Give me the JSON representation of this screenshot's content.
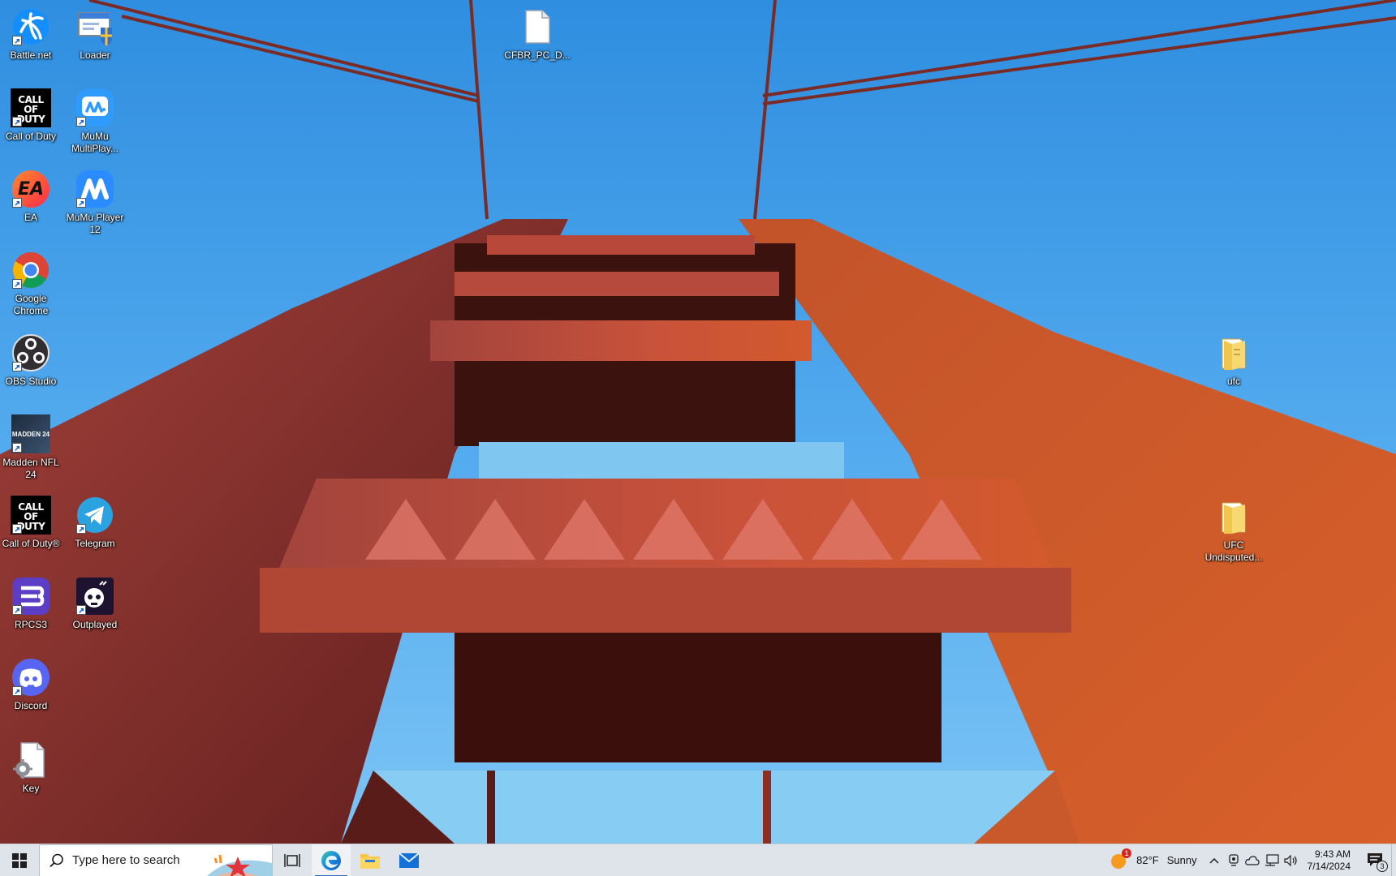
{
  "desktop": {
    "icons": [
      {
        "id": "battlenet",
        "label": "Battle.net",
        "icon": "battlenet-icon"
      },
      {
        "id": "loader",
        "label": "Loader",
        "icon": "loader-icon"
      },
      {
        "id": "cfbr",
        "label": "CFBR_PC_D...",
        "icon": "document-icon"
      },
      {
        "id": "cod",
        "label": "Call of Duty",
        "icon": "call-of-duty-icon"
      },
      {
        "id": "mumu-multi",
        "label": "MuMu MultiPlay...",
        "icon": "mumu-multiplayer-icon"
      },
      {
        "id": "ea",
        "label": "EA",
        "icon": "ea-icon"
      },
      {
        "id": "mumu12",
        "label": "MuMu Player 12",
        "icon": "mumu-player-icon"
      },
      {
        "id": "chrome",
        "label": "Google Chrome",
        "icon": "chrome-icon"
      },
      {
        "id": "obs",
        "label": "OBS Studio",
        "icon": "obs-icon"
      },
      {
        "id": "madden",
        "label": "Madden NFL 24",
        "icon": "madden-icon"
      },
      {
        "id": "cod2",
        "label": "Call of Duty®",
        "icon": "call-of-duty-icon"
      },
      {
        "id": "telegram",
        "label": "Telegram",
        "icon": "telegram-icon"
      },
      {
        "id": "rpcs3",
        "label": "RPCS3",
        "icon": "rpcs3-icon"
      },
      {
        "id": "outplayed",
        "label": "Outplayed",
        "icon": "outplayed-icon"
      },
      {
        "id": "discord",
        "label": "Discord",
        "icon": "discord-icon"
      },
      {
        "id": "key",
        "label": "Key",
        "icon": "key-file-icon"
      },
      {
        "id": "ufc",
        "label": "ufc",
        "icon": "folder-icon"
      },
      {
        "id": "ufc-und",
        "label": "UFC Undisputed...",
        "icon": "folder-icon"
      }
    ],
    "cod_logo_text": "CALL OF DUTY",
    "ea_logo_text": "EA",
    "madden_logo_text": "MADDEN 24"
  },
  "taskbar": {
    "search_placeholder": "Type here to search",
    "pinned": [
      "task-view-icon",
      "edge-icon",
      "file-explorer-icon",
      "mail-icon"
    ],
    "weather": {
      "temp": "82°F",
      "condition": "Sunny",
      "alert_count": "1"
    },
    "clock": {
      "time": "9:43 AM",
      "date": "7/14/2024"
    },
    "notifications": {
      "count": "3"
    },
    "colors": {
      "taskbar_bg": "#dfe3ea",
      "accent": "#2f6dc0"
    }
  }
}
